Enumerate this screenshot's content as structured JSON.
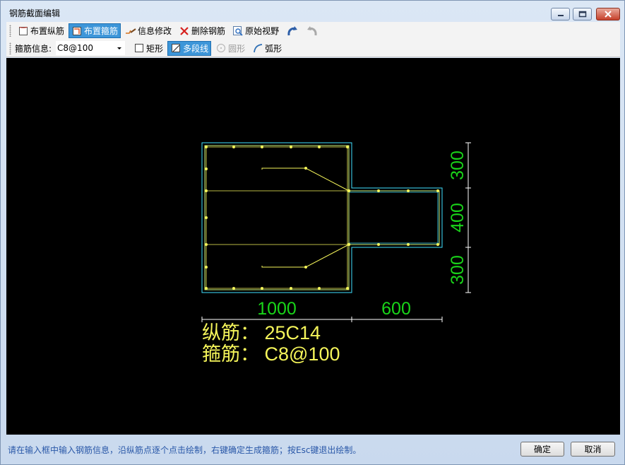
{
  "window": {
    "title": "钢筋截面编辑"
  },
  "toolbar1": {
    "items": [
      {
        "label": "布置纵筋",
        "icon": "longitudinal-rebar-icon"
      },
      {
        "label": "布置箍筋",
        "icon": "stirrup-icon",
        "active": true
      },
      {
        "label": "信息修改",
        "icon": "edit-info-icon"
      },
      {
        "label": "删除钢筋",
        "icon": "delete-x-icon"
      },
      {
        "label": "原始视野",
        "icon": "zoom-fit-icon"
      }
    ],
    "undo_icon": "undo-icon",
    "redo_icon": "redo-icon"
  },
  "toolbar2": {
    "stirrup_info_label": "箍筋信息:",
    "stirrup_value": "C8@100",
    "shapes": [
      {
        "label": "矩形",
        "icon": "rectangle-icon"
      },
      {
        "label": "多段线",
        "icon": "polyline-icon",
        "active": true
      },
      {
        "label": "圆形",
        "icon": "circle-icon",
        "disabled": true
      },
      {
        "label": "弧形",
        "icon": "arc-icon"
      }
    ]
  },
  "drawing": {
    "dims_bottom": [
      "1000",
      "600"
    ],
    "dims_right": [
      "300",
      "400",
      "300"
    ],
    "longitudinal_text": "纵筋： 25C14",
    "stirrup_text": "箍筋： C8@100",
    "colors": {
      "background": "#000000",
      "outline": "#3fe0ff",
      "rebar": "#f5f55a",
      "dimension_text": "#19d419",
      "dimension_line": "#ffffff",
      "info_text": "#f5f55a"
    }
  },
  "status": {
    "text": "请在输入框中输入钢筋信息，沿纵筋点逐个点击绘制，右键确定生成箍筋；按Esc键退出绘制。"
  },
  "buttons": {
    "ok": "确定",
    "cancel": "取消"
  }
}
